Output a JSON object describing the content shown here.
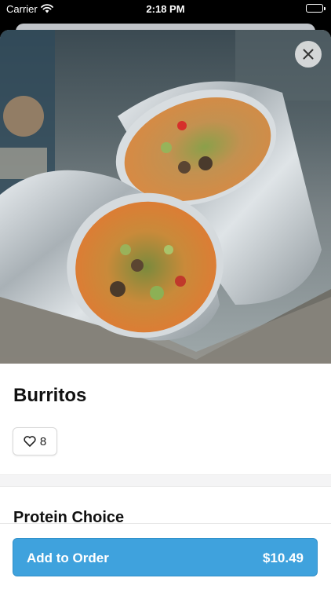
{
  "status_bar": {
    "carrier": "Carrier",
    "time": "2:18 PM",
    "battery_level": 1.0
  },
  "item": {
    "name": "Burritos",
    "image_icon": "burrito-photo",
    "likes": "8"
  },
  "sections": {
    "protein_title": "Protein Choice"
  },
  "order_bar": {
    "add_label": "Add to Order",
    "price": "$10.49",
    "accent_color": "#3fa2dd"
  },
  "icons": {
    "close": "close-icon",
    "like": "heart-icon",
    "wifi": "wifi-icon",
    "battery": "battery-icon"
  }
}
